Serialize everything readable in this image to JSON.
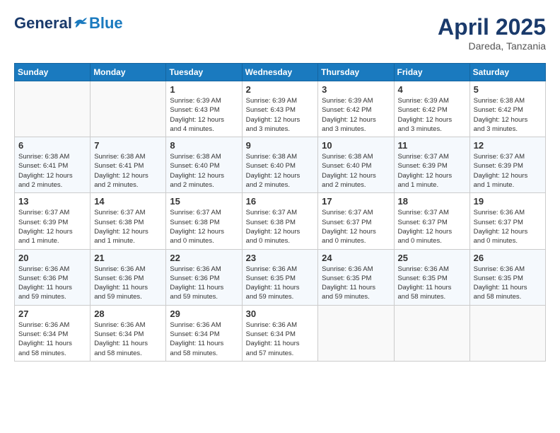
{
  "logo": {
    "general": "General",
    "blue": "Blue"
  },
  "title": {
    "month_year": "April 2025",
    "location": "Dareda, Tanzania"
  },
  "headers": [
    "Sunday",
    "Monday",
    "Tuesday",
    "Wednesday",
    "Thursday",
    "Friday",
    "Saturday"
  ],
  "weeks": [
    [
      {
        "day": "",
        "info": ""
      },
      {
        "day": "",
        "info": ""
      },
      {
        "day": "1",
        "info": "Sunrise: 6:39 AM\nSunset: 6:43 PM\nDaylight: 12 hours\nand 4 minutes."
      },
      {
        "day": "2",
        "info": "Sunrise: 6:39 AM\nSunset: 6:43 PM\nDaylight: 12 hours\nand 3 minutes."
      },
      {
        "day": "3",
        "info": "Sunrise: 6:39 AM\nSunset: 6:42 PM\nDaylight: 12 hours\nand 3 minutes."
      },
      {
        "day": "4",
        "info": "Sunrise: 6:39 AM\nSunset: 6:42 PM\nDaylight: 12 hours\nand 3 minutes."
      },
      {
        "day": "5",
        "info": "Sunrise: 6:38 AM\nSunset: 6:42 PM\nDaylight: 12 hours\nand 3 minutes."
      }
    ],
    [
      {
        "day": "6",
        "info": "Sunrise: 6:38 AM\nSunset: 6:41 PM\nDaylight: 12 hours\nand 2 minutes."
      },
      {
        "day": "7",
        "info": "Sunrise: 6:38 AM\nSunset: 6:41 PM\nDaylight: 12 hours\nand 2 minutes."
      },
      {
        "day": "8",
        "info": "Sunrise: 6:38 AM\nSunset: 6:40 PM\nDaylight: 12 hours\nand 2 minutes."
      },
      {
        "day": "9",
        "info": "Sunrise: 6:38 AM\nSunset: 6:40 PM\nDaylight: 12 hours\nand 2 minutes."
      },
      {
        "day": "10",
        "info": "Sunrise: 6:38 AM\nSunset: 6:40 PM\nDaylight: 12 hours\nand 2 minutes."
      },
      {
        "day": "11",
        "info": "Sunrise: 6:37 AM\nSunset: 6:39 PM\nDaylight: 12 hours\nand 1 minute."
      },
      {
        "day": "12",
        "info": "Sunrise: 6:37 AM\nSunset: 6:39 PM\nDaylight: 12 hours\nand 1 minute."
      }
    ],
    [
      {
        "day": "13",
        "info": "Sunrise: 6:37 AM\nSunset: 6:39 PM\nDaylight: 12 hours\nand 1 minute."
      },
      {
        "day": "14",
        "info": "Sunrise: 6:37 AM\nSunset: 6:38 PM\nDaylight: 12 hours\nand 1 minute."
      },
      {
        "day": "15",
        "info": "Sunrise: 6:37 AM\nSunset: 6:38 PM\nDaylight: 12 hours\nand 0 minutes."
      },
      {
        "day": "16",
        "info": "Sunrise: 6:37 AM\nSunset: 6:38 PM\nDaylight: 12 hours\nand 0 minutes."
      },
      {
        "day": "17",
        "info": "Sunrise: 6:37 AM\nSunset: 6:37 PM\nDaylight: 12 hours\nand 0 minutes."
      },
      {
        "day": "18",
        "info": "Sunrise: 6:37 AM\nSunset: 6:37 PM\nDaylight: 12 hours\nand 0 minutes."
      },
      {
        "day": "19",
        "info": "Sunrise: 6:36 AM\nSunset: 6:37 PM\nDaylight: 12 hours\nand 0 minutes."
      }
    ],
    [
      {
        "day": "20",
        "info": "Sunrise: 6:36 AM\nSunset: 6:36 PM\nDaylight: 11 hours\nand 59 minutes."
      },
      {
        "day": "21",
        "info": "Sunrise: 6:36 AM\nSunset: 6:36 PM\nDaylight: 11 hours\nand 59 minutes."
      },
      {
        "day": "22",
        "info": "Sunrise: 6:36 AM\nSunset: 6:36 PM\nDaylight: 11 hours\nand 59 minutes."
      },
      {
        "day": "23",
        "info": "Sunrise: 6:36 AM\nSunset: 6:35 PM\nDaylight: 11 hours\nand 59 minutes."
      },
      {
        "day": "24",
        "info": "Sunrise: 6:36 AM\nSunset: 6:35 PM\nDaylight: 11 hours\nand 59 minutes."
      },
      {
        "day": "25",
        "info": "Sunrise: 6:36 AM\nSunset: 6:35 PM\nDaylight: 11 hours\nand 58 minutes."
      },
      {
        "day": "26",
        "info": "Sunrise: 6:36 AM\nSunset: 6:35 PM\nDaylight: 11 hours\nand 58 minutes."
      }
    ],
    [
      {
        "day": "27",
        "info": "Sunrise: 6:36 AM\nSunset: 6:34 PM\nDaylight: 11 hours\nand 58 minutes."
      },
      {
        "day": "28",
        "info": "Sunrise: 6:36 AM\nSunset: 6:34 PM\nDaylight: 11 hours\nand 58 minutes."
      },
      {
        "day": "29",
        "info": "Sunrise: 6:36 AM\nSunset: 6:34 PM\nDaylight: 11 hours\nand 58 minutes."
      },
      {
        "day": "30",
        "info": "Sunrise: 6:36 AM\nSunset: 6:34 PM\nDaylight: 11 hours\nand 57 minutes."
      },
      {
        "day": "",
        "info": ""
      },
      {
        "day": "",
        "info": ""
      },
      {
        "day": "",
        "info": ""
      }
    ]
  ]
}
